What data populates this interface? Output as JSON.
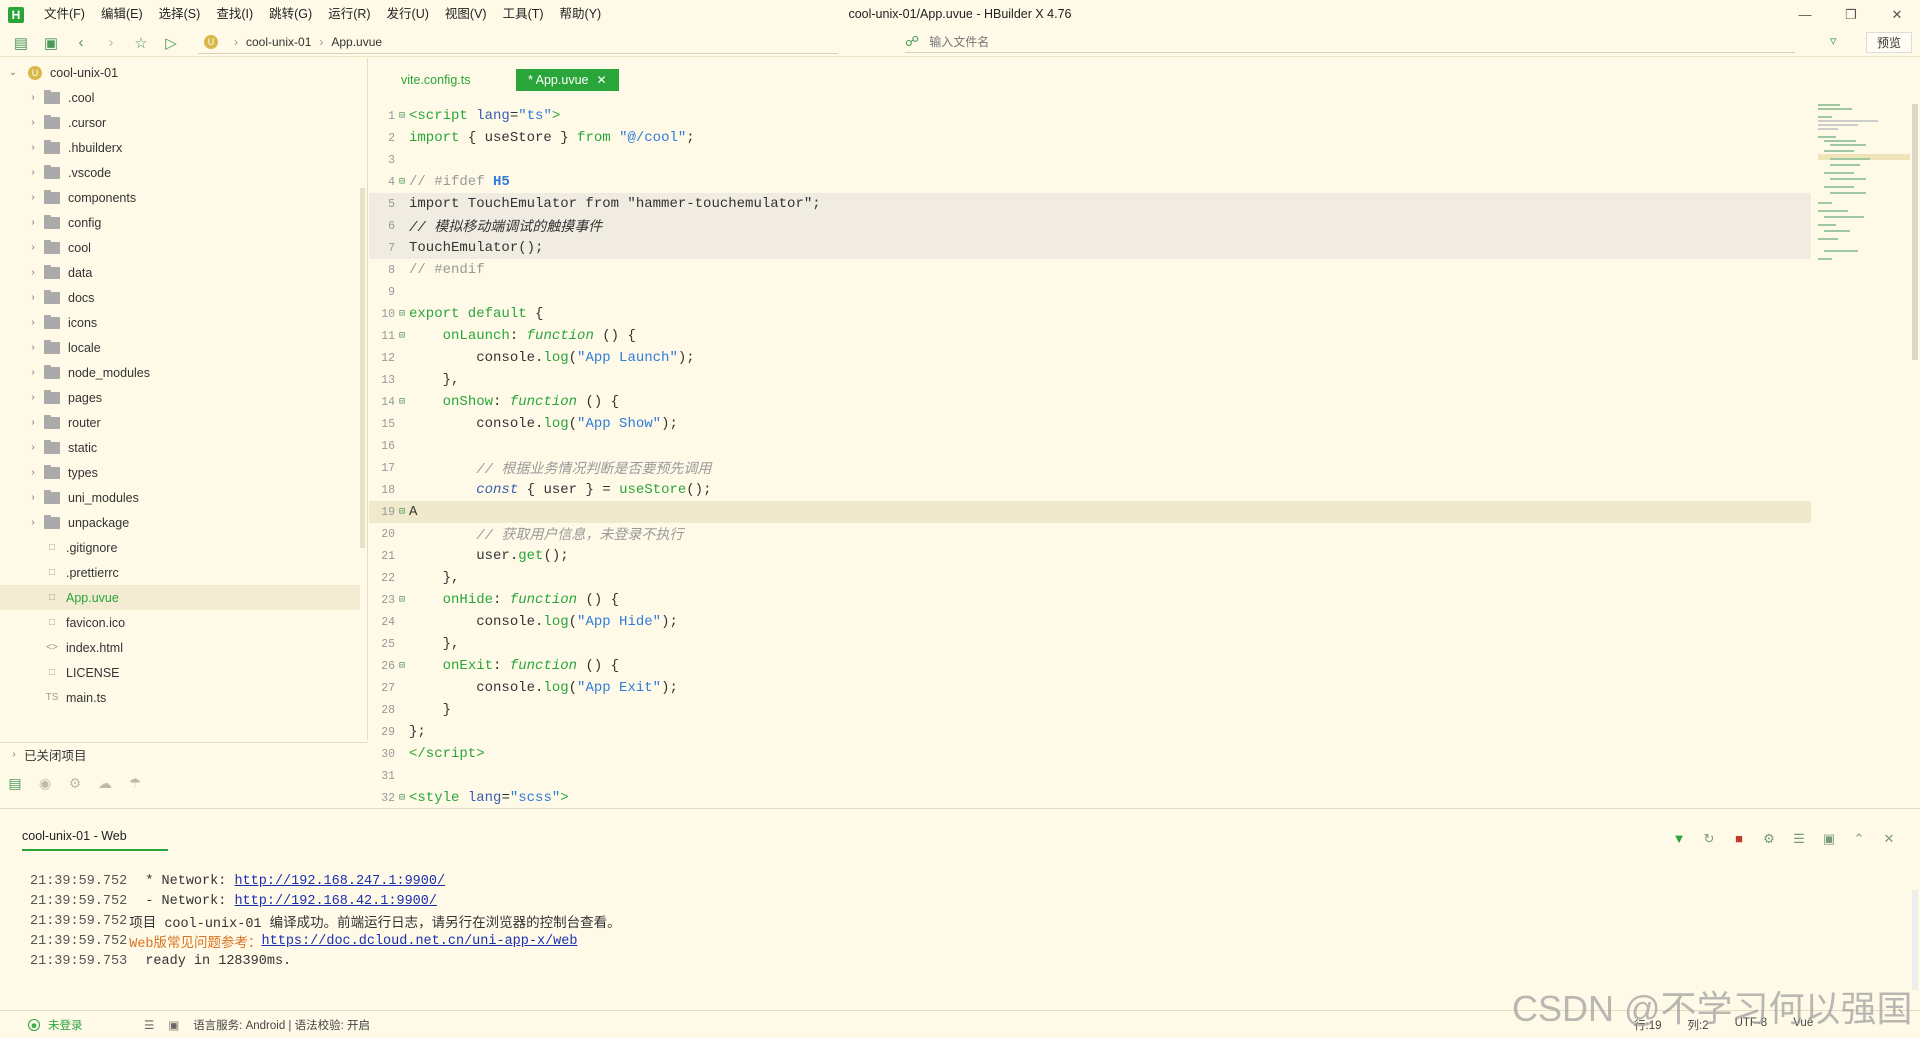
{
  "window": {
    "title": "cool-unix-01/App.uvue - HBuilder X 4.76",
    "logo": "H",
    "controls": [
      "minimize-icon",
      "restore-icon",
      "close-icon"
    ]
  },
  "menu": [
    "文件(F)",
    "编辑(E)",
    "选择(S)",
    "查找(I)",
    "跳转(G)",
    "运行(R)",
    "发行(U)",
    "视图(V)",
    "工具(T)",
    "帮助(Y)"
  ],
  "toolbar": {
    "breadcrumb": [
      "cool-unix-01",
      "App.uvue"
    ],
    "search_placeholder": "输入文件名",
    "preview_label": "预览"
  },
  "sidebar": {
    "project": "cool-unix-01",
    "items": [
      {
        "label": ".cool",
        "type": "folder"
      },
      {
        "label": ".cursor",
        "type": "folder"
      },
      {
        "label": ".hbuilderx",
        "type": "folder"
      },
      {
        "label": ".vscode",
        "type": "folder"
      },
      {
        "label": "components",
        "type": "folder"
      },
      {
        "label": "config",
        "type": "folder"
      },
      {
        "label": "cool",
        "type": "folder"
      },
      {
        "label": "data",
        "type": "folder"
      },
      {
        "label": "docs",
        "type": "folder"
      },
      {
        "label": "icons",
        "type": "folder"
      },
      {
        "label": "locale",
        "type": "folder"
      },
      {
        "label": "node_modules",
        "type": "folder"
      },
      {
        "label": "pages",
        "type": "folder"
      },
      {
        "label": "router",
        "type": "folder"
      },
      {
        "label": "static",
        "type": "folder"
      },
      {
        "label": "types",
        "type": "folder"
      },
      {
        "label": "uni_modules",
        "type": "folder"
      },
      {
        "label": "unpackage",
        "type": "folder"
      },
      {
        "label": ".gitignore",
        "type": "file"
      },
      {
        "label": ".prettierrc",
        "type": "file"
      },
      {
        "label": "App.uvue",
        "type": "file"
      },
      {
        "label": "favicon.ico",
        "type": "file"
      },
      {
        "label": "index.html",
        "type": "file"
      },
      {
        "label": "LICENSE",
        "type": "file"
      },
      {
        "label": "main.ts",
        "type": "file"
      }
    ],
    "closed_projects": "已关闭项目"
  },
  "tabs": [
    {
      "label": "vite.config.ts",
      "active": false
    },
    {
      "label": "* App.uvue",
      "active": true
    }
  ],
  "editor": {
    "line_numbers": [
      "1",
      "2",
      "3",
      "4",
      "5",
      "6",
      "7",
      "8",
      "9",
      "10",
      "11",
      "12",
      "13",
      "14",
      "15",
      "16",
      "17",
      "18",
      "19",
      "20",
      "21",
      "22",
      "23",
      "24",
      "25",
      "26",
      "27",
      "28",
      "29",
      "30",
      "31",
      "32"
    ]
  },
  "console": {
    "tab": "cool-unix-01 - Web",
    "lines": [
      {
        "time": "21:39:59.752",
        "text": " * Network: ",
        "link": "http://192.168.247.1:9900/"
      },
      {
        "time": "21:39:59.752",
        "text": " - Network: ",
        "link": "http://192.168.42.1:9900/"
      },
      {
        "time": "21:39:59.752",
        "text": "项目 cool-unix-01 编译成功。前端运行日志，请另行在浏览器的控制台查看。",
        "link": ""
      },
      {
        "time": "21:39:59.752",
        "warn": "Web版常见问题参考：",
        "link": "https://doc.dcloud.net.cn/uni-app-x/web"
      },
      {
        "time": "21:39:59.753",
        "text": " ready in 128390ms.",
        "link": ""
      }
    ]
  },
  "status": {
    "user": "未登录",
    "lang": "语言服务: Android | 语法校验: 开启",
    "line": "行:19",
    "col": "列:2",
    "encoding": "UTF-8",
    "syntax": "Vue"
  },
  "watermark": "CSDN @不学习何以强国"
}
